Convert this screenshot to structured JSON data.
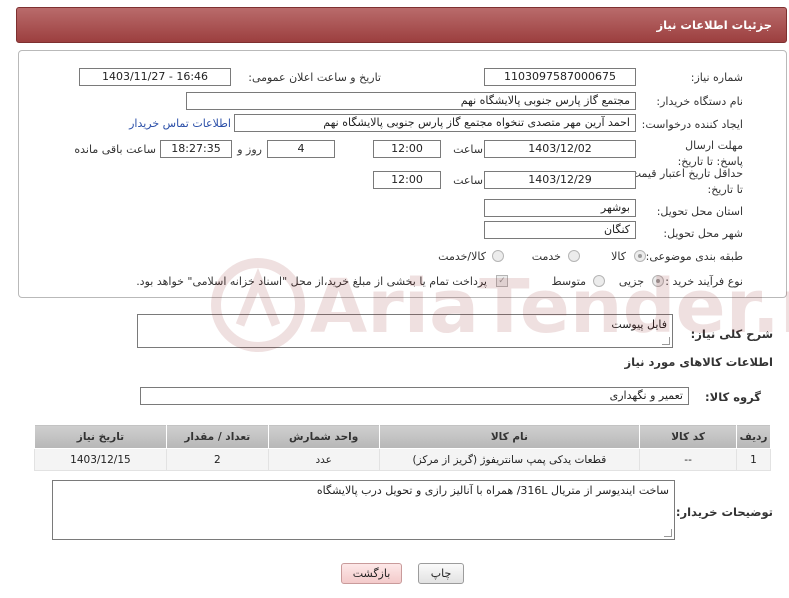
{
  "header": {
    "title": "جزئیات اطلاعات نیاز"
  },
  "form": {
    "need_number_label": "شماره نیاز:",
    "need_number": "1103097587000675",
    "announce_label": "تاریخ و ساعت اعلان عمومی:",
    "announce_value": "1403/11/27 - 16:46",
    "buyer_org_label": "نام دستگاه خریدار:",
    "buyer_org": "مجتمع گاز پارس جنوبی  پالایشگاه نهم",
    "requester_label": "ایجاد کننده درخواست:",
    "requester": "احمد آرین مهر متصدی تنخواه مجتمع گاز پارس جنوبی  پالایشگاه نهم",
    "contact_link": "اطلاعات تماس خریدار",
    "deadline_label": "مهلت ارسال پاسخ: تا تاریخ:",
    "deadline_date": "1403/12/02",
    "deadline_time_label": "ساعت",
    "deadline_time": "12:00",
    "days_value": "4",
    "days_label": "روز و",
    "remaining_value": "18:27:35",
    "remaining_label": "ساعت باقی مانده",
    "validity_label": "حداقل تاریخ اعتبار قیمت: تا تاریخ:",
    "validity_date": "1403/12/29",
    "validity_time_label": "ساعت",
    "validity_time": "12:00",
    "province_label": "استان محل تحویل:",
    "province": "بوشهر",
    "city_label": "شهر محل تحویل:",
    "city": "کنگان",
    "category_label": "طبقه بندی موضوعی:",
    "category_options": [
      "کالا",
      "خدمت",
      "کالا/خدمت"
    ],
    "category_selected": "کالا",
    "process_label": "نوع فرآیند خرید :",
    "process_options": [
      "جزیی",
      "متوسط"
    ],
    "process_selected": "جزیی",
    "payment_note": "پرداخت تمام یا بخشی از مبلغ خرید،از محل \"اسناد خزانه اسلامی\" خواهد بود."
  },
  "description": {
    "label": "شرح کلی نیاز:",
    "value": "فایل پیوست"
  },
  "goods": {
    "section_title": "اطلاعات کالاهای مورد نیاز",
    "group_label": "گروه کالا:",
    "group_value": "تعمیر و نگهداری",
    "columns": [
      "ردیف",
      "کد کالا",
      "نام کالا",
      "واحد شمارش",
      "تعداد / مقدار",
      "تاریخ نیاز"
    ],
    "rows": [
      [
        "1",
        "--",
        "قطعات یدکی پمپ سانتریفوژ (گریز از مرکز)",
        "عدد",
        "2",
        "1403/12/15"
      ]
    ]
  },
  "buyer_notes": {
    "label": "توضیحات خریدار:",
    "value": "ساخت اینديوسر از متريال 316L/ همراه با آناليز رازی و تحويل درب پالايشگاه"
  },
  "buttons": {
    "print": "چاپ",
    "back": "بازگشت"
  },
  "watermark": {
    "text": "AriaTender.neT"
  },
  "colors": {
    "header": "#a84c4c",
    "link": "#2b4fa8",
    "table_header": "#c4c4c4",
    "back_button": "#f3caca"
  }
}
